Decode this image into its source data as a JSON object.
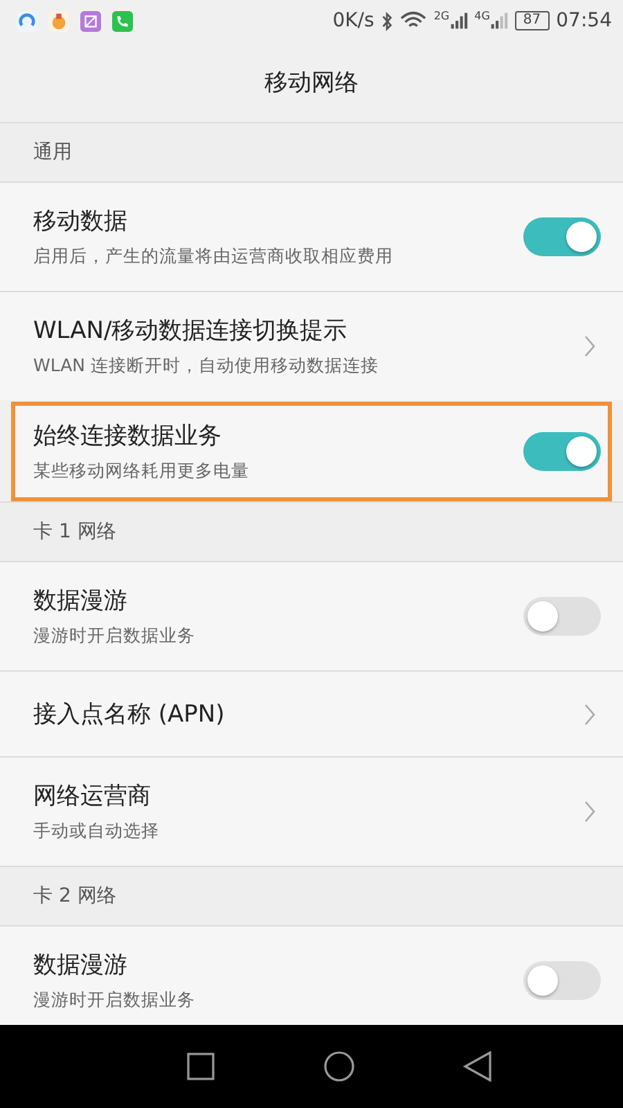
{
  "status_bar": {
    "speed": "0K/s",
    "sim1": "2G",
    "sim2": "4G",
    "battery": "87",
    "time": "07:54"
  },
  "title": "移动网络",
  "sections": [
    {
      "header": "通用",
      "items": [
        {
          "kind": "toggle",
          "title": "移动数据",
          "subtitle": "启用后，产生的流量将由运营商收取相应费用",
          "on": true,
          "highlighted": false
        },
        {
          "kind": "link",
          "title": "WLAN/移动数据连接切换提示",
          "subtitle": "WLAN 连接断开时，自动使用移动数据连接",
          "highlighted": false
        },
        {
          "kind": "toggle",
          "title": "始终连接数据业务",
          "subtitle": "某些移动网络耗用更多电量",
          "on": true,
          "highlighted": true
        }
      ]
    },
    {
      "header": "卡 1 网络",
      "items": [
        {
          "kind": "toggle",
          "title": "数据漫游",
          "subtitle": "漫游时开启数据业务",
          "on": false,
          "highlighted": false
        },
        {
          "kind": "link",
          "title": "接入点名称 (APN)",
          "highlighted": false
        },
        {
          "kind": "link",
          "title": "网络运营商",
          "subtitle": "手动或自动选择",
          "highlighted": false
        }
      ]
    },
    {
      "header": "卡 2 网络",
      "items": [
        {
          "kind": "toggle",
          "title": "数据漫游",
          "subtitle": "漫游时开启数据业务",
          "on": false,
          "highlighted": false
        }
      ]
    }
  ]
}
